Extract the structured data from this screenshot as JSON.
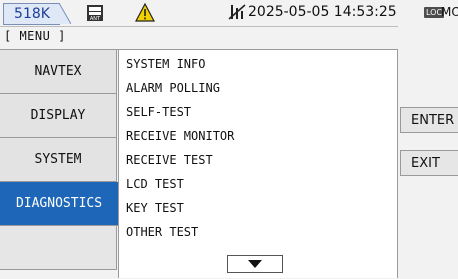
{
  "status_bar": {
    "freq_tab": "518K",
    "datetime": "2025-05-05 14:53:25",
    "loc_badge": "LOC",
    "mode": "MON",
    "icons": [
      "ant-icon",
      "warning-icon",
      "no-signal-icon"
    ],
    "warning_color": "#f2d100"
  },
  "menu_title": "[ MENU ]",
  "tabs": [
    {
      "label": "NAVTEX"
    },
    {
      "label": "DISPLAY"
    },
    {
      "label": "SYSTEM"
    },
    {
      "label": "DIAGNOSTICS",
      "selected": true
    },
    {
      "label": ""
    }
  ],
  "list_items": [
    "SYSTEM INFO",
    "ALARM POLLING",
    "SELF-TEST",
    "RECEIVE MONITOR",
    "RECEIVE TEST",
    "LCD TEST",
    "KEY TEST",
    "OTHER TEST"
  ],
  "softkeys": {
    "enter": "ENTER",
    "exit": "EXIT"
  },
  "accent_color": "#1e66b8"
}
